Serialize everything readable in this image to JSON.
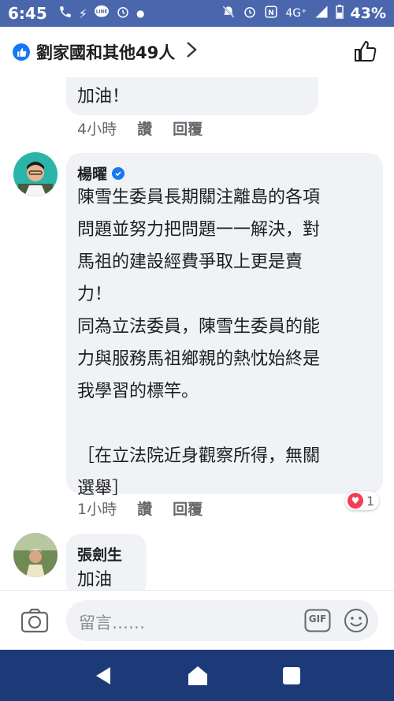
{
  "status_bar": {
    "time": "6:45",
    "network": "4G⁺",
    "battery": "43%"
  },
  "header": {
    "title": "劉家國和其他49人",
    "icons": [
      "like-badge-icon",
      "chevron-right-icon",
      "thumbs-up-outline-icon"
    ]
  },
  "comments": [
    {
      "text": "加油！",
      "time": "4小時",
      "like_label": "讚",
      "reply_label": "回覆"
    },
    {
      "author": "楊曜",
      "verified": true,
      "text": "陳雪生委員長期關注離島的各項\n問題並努力把問題一一解決，對\n馬祖的建設經費爭取上更是賣\n力！\n同為立法委員，陳雪生委員的能\n力與服務馬祖鄉親的熱忱始終是\n我學習的標竿。\n\n［在立法院近身觀察所得，無關\n選舉］",
      "time": "1小時",
      "like_label": "讚",
      "reply_label": "回覆",
      "reaction_count": "1",
      "reaction_color": "#f33e58"
    },
    {
      "author": "張劍生",
      "text": "加油"
    }
  ],
  "composer": {
    "placeholder": "留言……",
    "gif_label": "GIF",
    "icons": [
      "camera-icon",
      "gif-icon",
      "emoji-icon"
    ]
  },
  "nav": {
    "icons": [
      "back-icon",
      "home-icon",
      "recents-icon"
    ]
  },
  "colors": {
    "status_bar": "#4a67ad",
    "nav_bar": "#1d3a78",
    "bubble": "#f0f2f5",
    "brand": "#1877f2"
  }
}
